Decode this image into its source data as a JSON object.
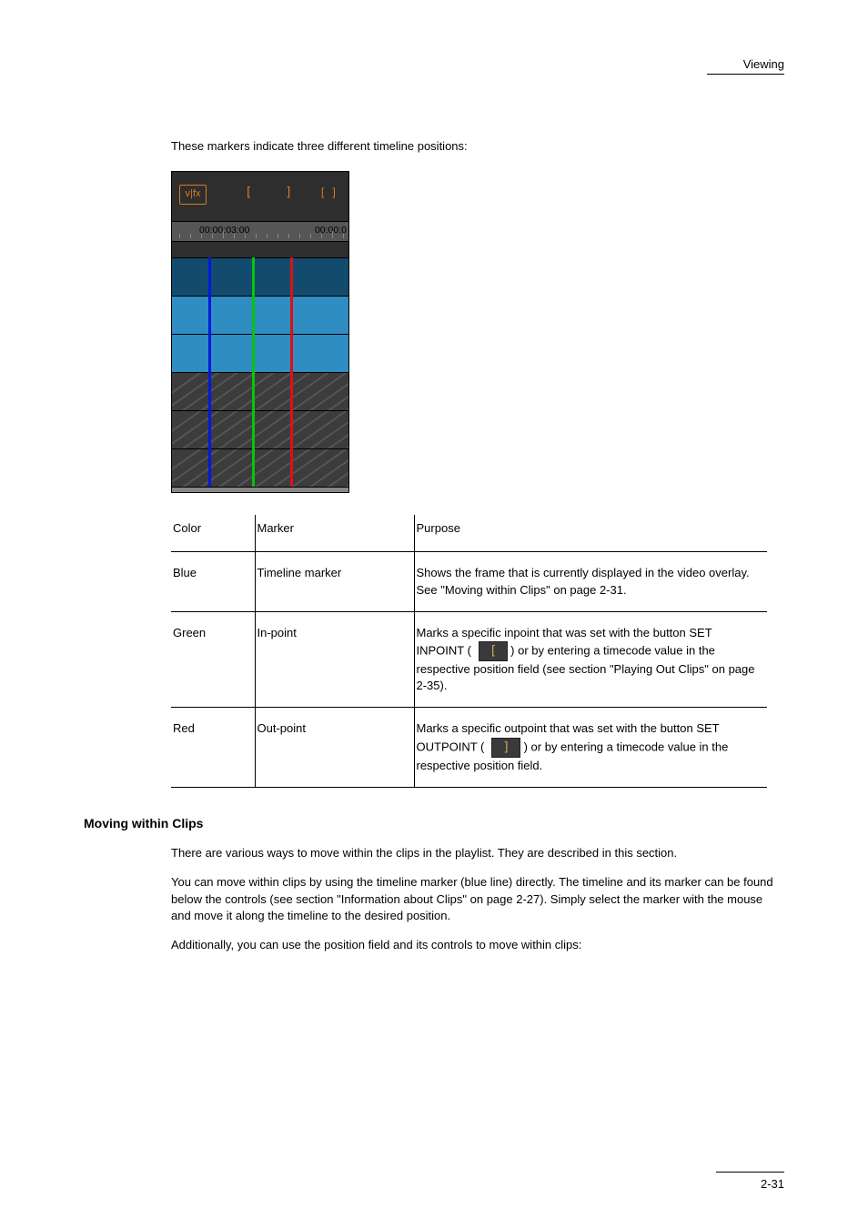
{
  "header": {
    "running_title": "Viewing"
  },
  "intro": "These markers indicate three different timeline positions:",
  "figure": {
    "toolbar": {
      "vfx": "v|fx",
      "in_glyph": "[",
      "out_glyph": "]",
      "inout_glyph": "[ ]"
    },
    "ruler": {
      "tc1": "00:00:03:00",
      "tc2": "00:00:0"
    },
    "marker_colors": {
      "blue": "#0019e0",
      "green": "#07c40b",
      "red": "#e01010"
    }
  },
  "table": {
    "headers": {
      "col1": "Color",
      "col2": "Marker",
      "col3": "Purpose"
    },
    "rows": [
      {
        "color": "Blue",
        "marker": "Timeline marker",
        "purpose": "Shows the frame that is currently displayed in the video overlay. See \"Moving within Clips\" on page 2-31."
      },
      {
        "color": "Green",
        "marker": "In-point",
        "purpose_before": "Marks a specific inpoint that was set with the button SET INPOINT ( ",
        "purpose_after": " ) or by entering a timecode value in the respective position field (see section \"Playing Out Clips\" on page 2-35)."
      },
      {
        "color": "Red",
        "marker": "Out-point",
        "purpose_before": "Marks a specific outpoint that was set with the button SET OUTPOINT ( ",
        "purpose_after": " ) or by entering a timecode value in the respective position field."
      }
    ]
  },
  "section": {
    "heading": "Moving within Clips",
    "p1": "There are various ways to move within the clips in the playlist. They are described in this section.",
    "p2": "You can move within clips by using the timeline marker (blue line) directly. The timeline and its marker can be found below the controls (see section \"Information about Clips\" on page 2-27). Simply select the marker with the mouse and move it along the timeline to the desired position.",
    "p3": "Additionally, you can use the position field and its controls to move within clips:"
  },
  "footer": {
    "page_number": "2-31"
  },
  "icons": {
    "set_in_glyph": "[",
    "set_out_glyph": "]"
  }
}
